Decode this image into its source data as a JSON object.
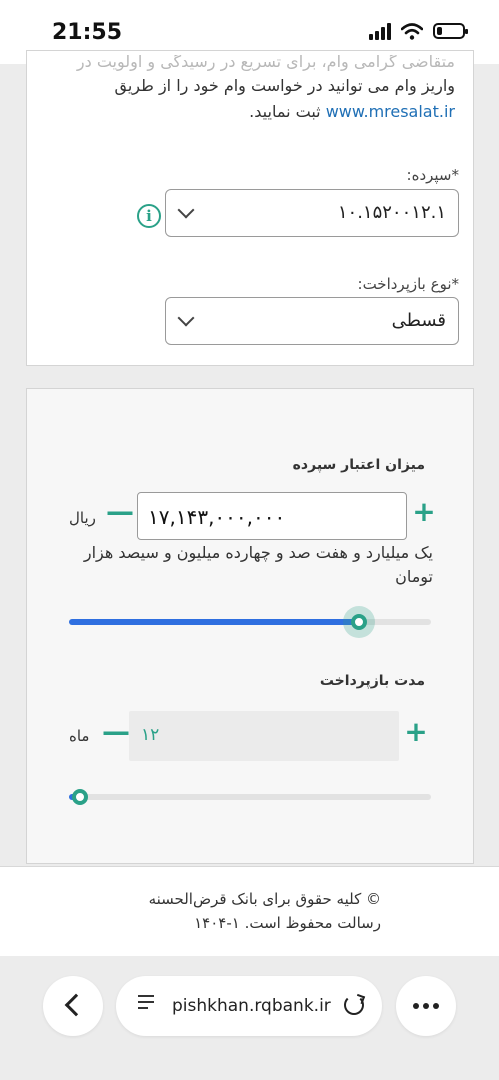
{
  "status_bar": {
    "time": "21:55",
    "battery_percent": 20
  },
  "intro": {
    "line_ghost": "متقاضی گرامی وام، برای تسریع در رسیدگی و اولویت در",
    "line_1": "واریز وام می توانید در خواست وام خود را از طریق",
    "link": "www.mresalat.ir",
    "line_2_suffix": "ثبت نمایید."
  },
  "deposit": {
    "label": "*سپرده:",
    "value": "۱۰.۱۵۲۰۰۱۲.۱",
    "info_icon": "i"
  },
  "repayment_type": {
    "label": "*نوع بازپرداخت:",
    "value": "قسطی"
  },
  "calculator": {
    "credit_label": "میزان اعتبار سپرده",
    "amount": "۱۷,۱۴۳,۰۰۰,۰۰۰",
    "amount_unit": "ریال",
    "amount_words": "یک میلیارد و هفت صد و چهارده میلیون و سیصد هزار تومان",
    "amount_slider_level": 0.8,
    "term_label": "مدت بازپرداخت",
    "term_value": "۱۲",
    "term_unit": "ماه",
    "term_slider_level": 0.03,
    "plus_symbol": "+",
    "minus_symbol": "—"
  },
  "footer": {
    "line_1": "© کلیه حقوق برای بانک قرض‌الحسنه",
    "line_2": "رسالت محفوظ است. ۱-۱۴۰۴"
  },
  "browser": {
    "url": "pishkhan.rqbank.ir"
  },
  "colors": {
    "accent": "#2aa188",
    "slider_fill": "#2f6fe0",
    "link": "#1f6fb5"
  }
}
